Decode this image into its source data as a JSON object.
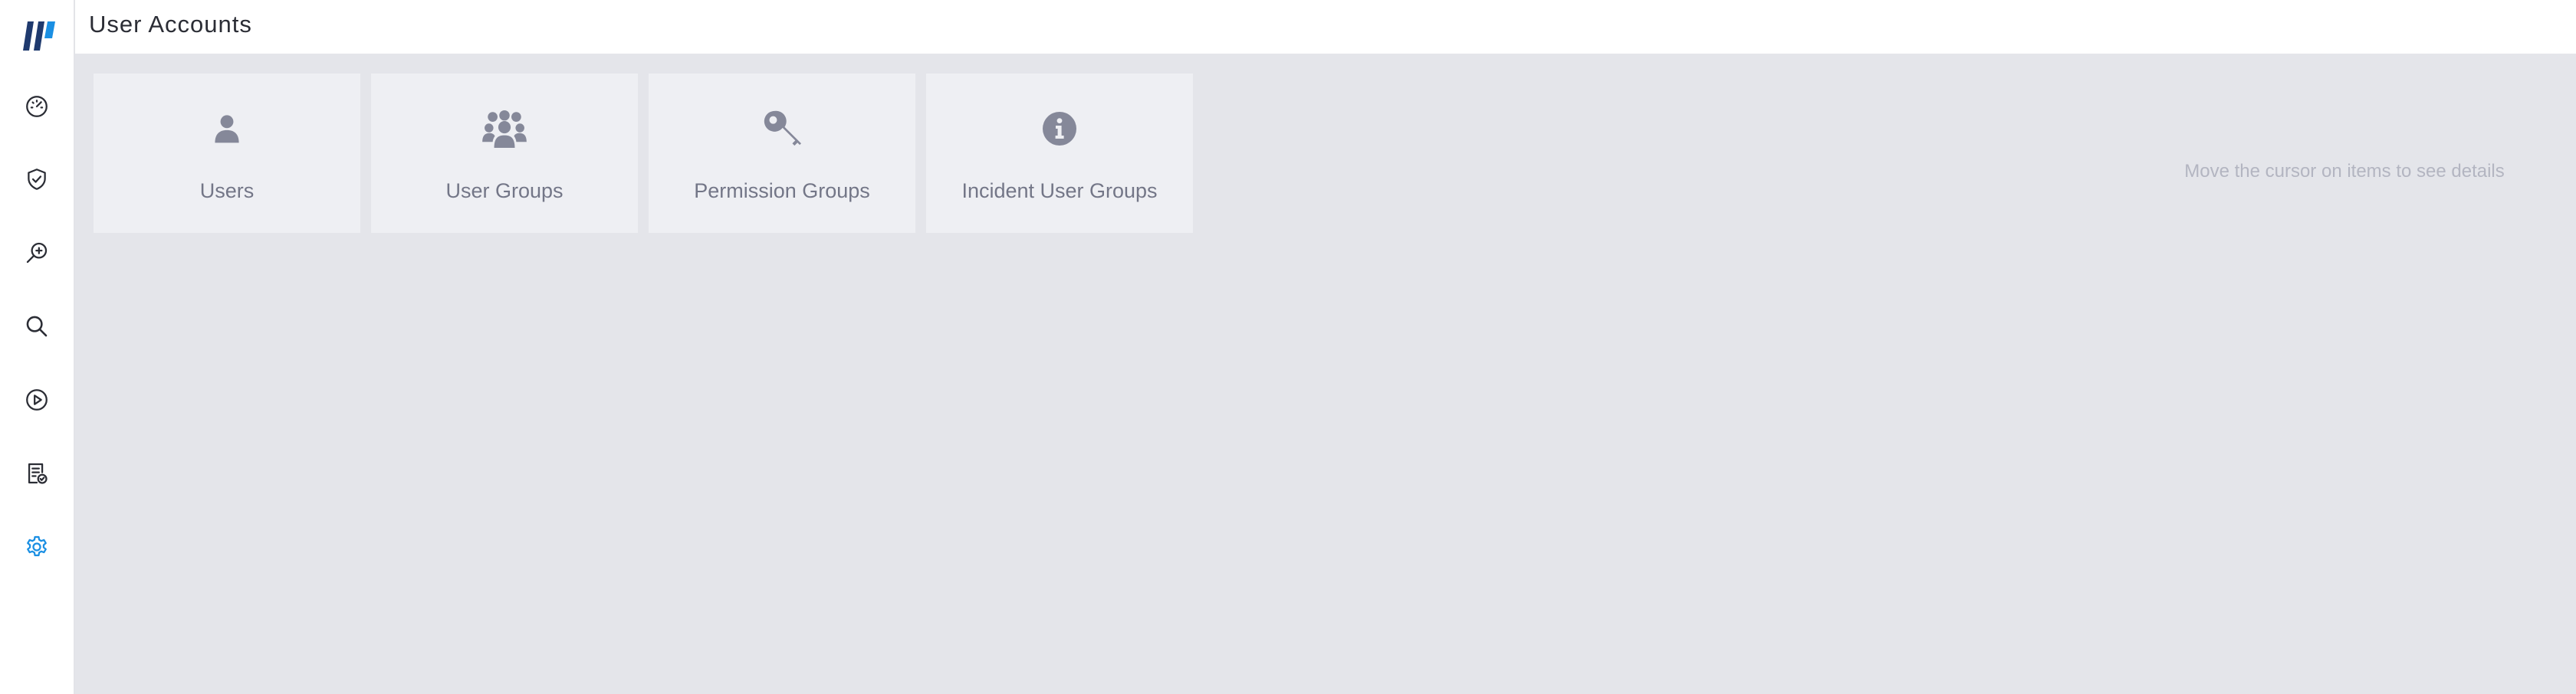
{
  "header": {
    "title": "User Accounts"
  },
  "sidebar": {
    "items": [
      {
        "icon": "dashboard-gauge-icon"
      },
      {
        "icon": "shield-check-icon"
      },
      {
        "icon": "investigate-search-icon"
      },
      {
        "icon": "search-icon"
      },
      {
        "icon": "play-circle-icon"
      },
      {
        "icon": "report-icon"
      },
      {
        "icon": "settings-gear-icon",
        "active": true
      }
    ],
    "colors": {
      "icon": "#2b2d35",
      "active": "#1a8fe3"
    }
  },
  "cards": [
    {
      "label": "Users",
      "icon": "user-icon"
    },
    {
      "label": "User Groups",
      "icon": "users-group-icon"
    },
    {
      "label": "Permission Groups",
      "icon": "key-icon"
    },
    {
      "label": "Incident User Groups",
      "icon": "info-circle-icon"
    }
  ],
  "hint": "Move the cursor on items to see details",
  "colors": {
    "background": "#e4e5ea",
    "card": "#eeeff3",
    "card_icon": "#858899",
    "brand_dark": "#1f3a6e",
    "brand_blue": "#1a8fe3"
  }
}
